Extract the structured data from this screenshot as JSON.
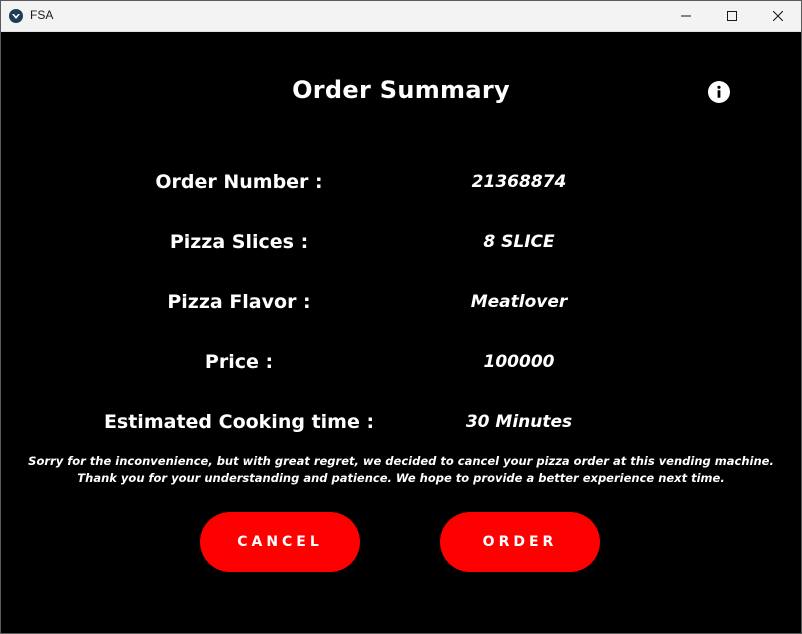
{
  "window": {
    "title": "FSA"
  },
  "header": {
    "title": "Order Summary"
  },
  "summary": {
    "rows": [
      {
        "label": "Order Number :",
        "value": "21368874"
      },
      {
        "label": "Pizza Slices :",
        "value": "8 SLICE"
      },
      {
        "label": "Pizza Flavor :",
        "value": "Meatlover"
      },
      {
        "label": "Price :",
        "value": "100000"
      },
      {
        "label": "Estimated Cooking time :",
        "value": "30 Minutes"
      }
    ]
  },
  "notice": {
    "line1": "Sorry for the inconvenience, but with great regret, we decided to cancel your pizza order at this vending machine.",
    "line2": "Thank you for your understanding and patience. We hope to provide a better experience next time."
  },
  "actions": {
    "cancel_label": "CANCEL",
    "order_label": "ORDER"
  },
  "icons": {
    "info": "info-icon",
    "minimize": "minimize-icon",
    "maximize": "maximize-icon",
    "close": "close-icon"
  },
  "colors": {
    "background": "#000000",
    "accent": "#ff0000",
    "text": "#ffffff"
  }
}
